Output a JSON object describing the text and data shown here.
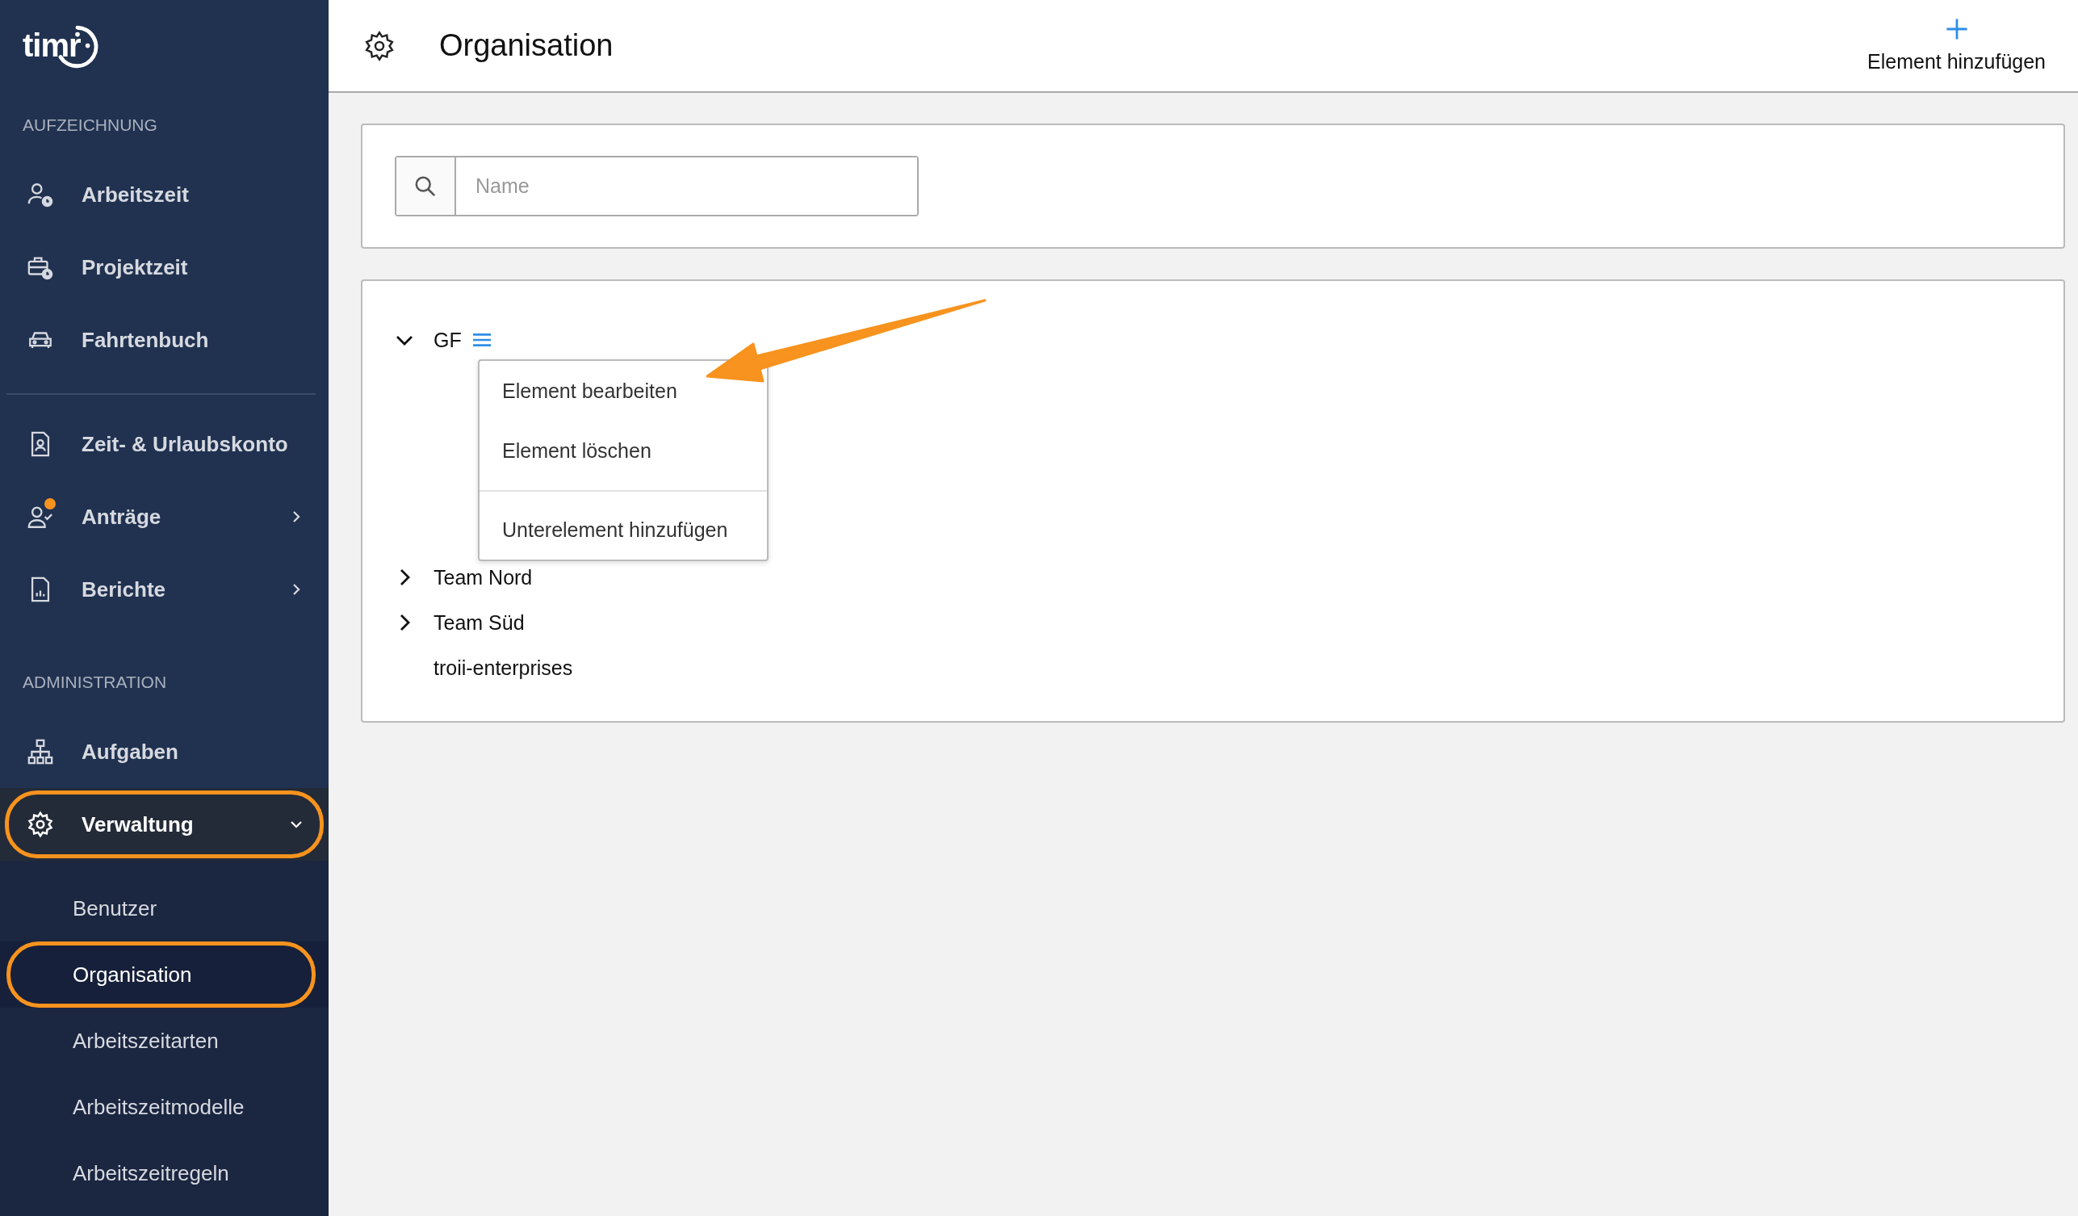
{
  "sidebar": {
    "logo": "timr",
    "sections": [
      {
        "label": "AUFZEICHNUNG",
        "items": [
          {
            "label": "Arbeitszeit",
            "kind": "link"
          },
          {
            "label": "Projektzeit",
            "kind": "link"
          },
          {
            "label": "Fahrtenbuch",
            "kind": "link"
          }
        ]
      },
      {
        "divider_above": true,
        "items": [
          {
            "label": "Zeit- & Urlaubskonto",
            "kind": "link"
          },
          {
            "label": "Anträge",
            "kind": "group",
            "expanded": false,
            "badge": true
          },
          {
            "label": "Berichte",
            "kind": "group",
            "expanded": false
          }
        ]
      },
      {
        "label": "ADMINISTRATION",
        "items": [
          {
            "label": "Aufgaben",
            "kind": "link"
          },
          {
            "label": "Verwaltung",
            "kind": "group",
            "expanded": true,
            "highlighted": true,
            "children": [
              {
                "label": "Benutzer",
                "selected": false,
                "highlighted": false
              },
              {
                "label": "Organisation",
                "selected": true,
                "highlighted": true
              },
              {
                "label": "Arbeitszeitarten",
                "selected": false,
                "highlighted": false
              },
              {
                "label": "Arbeitszeitmodelle",
                "selected": false,
                "highlighted": false
              },
              {
                "label": "Arbeitszeitregeln",
                "selected": false,
                "highlighted": false
              }
            ]
          }
        ]
      }
    ]
  },
  "header": {
    "title": "Organisation",
    "add_button": "Element hinzufügen"
  },
  "search": {
    "placeholder": "Name"
  },
  "tree": [
    {
      "label": "GF",
      "kind": "branch",
      "expanded": true,
      "menu_open": true
    },
    {
      "label": "Team Nord",
      "kind": "branch",
      "expanded": false
    },
    {
      "label": "Team Süd",
      "kind": "branch",
      "expanded": false
    },
    {
      "label": "troii-enterprises",
      "kind": "leaf"
    }
  ],
  "context_menu": {
    "items": [
      {
        "label": "Element bearbeiten"
      },
      {
        "label": "Element löschen"
      },
      {
        "label": "Unterelement hinzufügen",
        "divider_above": true
      }
    ]
  },
  "annotation": {
    "arrow": true
  }
}
